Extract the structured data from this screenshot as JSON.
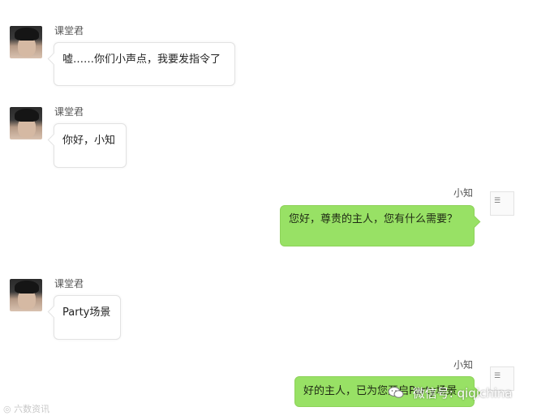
{
  "chat": {
    "messages": [
      {
        "sender": "课堂君",
        "text": "嘘……你们小声点，我要发指令了",
        "side": "left"
      },
      {
        "sender": "课堂君",
        "text": "你好，小知",
        "side": "left"
      },
      {
        "sender": "小知",
        "text": "您好，尊贵的主人，您有什么需要？",
        "side": "right"
      },
      {
        "sender": "课堂君",
        "text": "Party场景",
        "side": "left"
      },
      {
        "sender": "小知",
        "text": "好的主人，已为您开启Party场景",
        "side": "right"
      }
    ]
  },
  "watermarks": {
    "left": "六数资讯",
    "right": "微信号: qiqichina"
  },
  "colors": {
    "outgoing_bubble": "#98e165",
    "incoming_bubble": "#ffffff",
    "background": "#ffffff"
  },
  "icons": {
    "incoming_avatar": "user-photo-avatar",
    "outgoing_avatar": "smart-assistant-avatar",
    "watermark": "wechat-icon"
  }
}
